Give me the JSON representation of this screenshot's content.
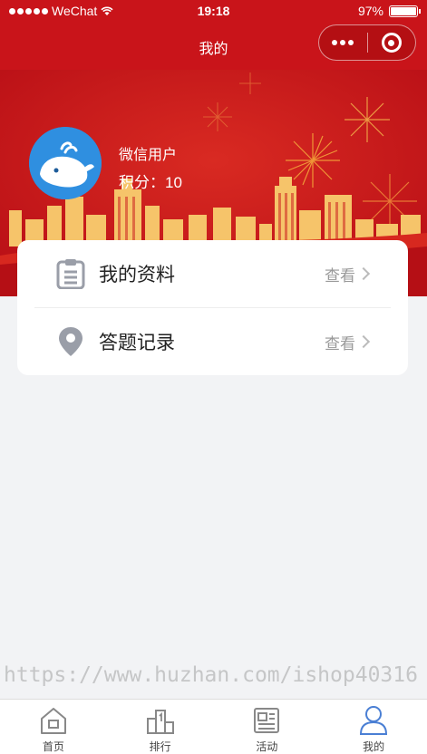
{
  "status_bar": {
    "carrier": "WeChat",
    "time": "19:18",
    "battery": "97%",
    "battery_level": 0.97
  },
  "nav": {
    "title": "我的"
  },
  "profile": {
    "name": "微信用户",
    "points_text": "积分：10"
  },
  "menu": [
    {
      "label": "我的资料",
      "action": "查看",
      "icon": "clipboard-icon"
    },
    {
      "label": "答题记录",
      "action": "查看",
      "icon": "location-pin-icon"
    }
  ],
  "watermark": "https://www.huzhan.com/ishop40316",
  "tabbar": [
    {
      "label": "首页",
      "icon": "home-icon"
    },
    {
      "label": "排行",
      "icon": "podium-icon"
    },
    {
      "label": "活动",
      "icon": "newspaper-icon"
    },
    {
      "label": "我的",
      "icon": "user-icon",
      "active": true
    }
  ],
  "colors": {
    "primary": "#c9141a",
    "gold": "#f6c46a",
    "active_tab": "#4a7fd4",
    "inactive_tab": "#888888"
  }
}
